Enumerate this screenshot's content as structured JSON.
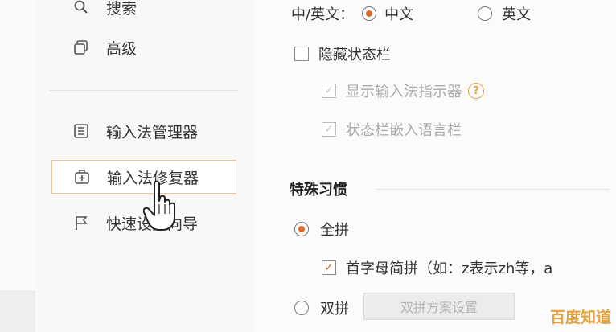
{
  "sidebar": {
    "items": [
      {
        "label": "搜索",
        "icon": "search-icon"
      },
      {
        "label": "高级",
        "icon": "advanced-icon"
      },
      {
        "label": "输入法管理器",
        "icon": "manager-icon"
      },
      {
        "label": "输入法修复器",
        "icon": "repair-icon",
        "active": true
      },
      {
        "label": "快速设置向导",
        "icon": "flag-icon"
      }
    ]
  },
  "settings": {
    "lang_label": "中/英文：",
    "lang_options": [
      {
        "label": "中文",
        "selected": true
      },
      {
        "label": "英文",
        "selected": false
      }
    ],
    "hide_status_bar": {
      "label": "隐藏状态栏",
      "checked": false
    },
    "show_indicator": {
      "label": "显示输入法指示器",
      "checked": true,
      "disabled": true
    },
    "embed_language_bar": {
      "label": "状态栏嵌入语言栏",
      "checked": true,
      "disabled": true
    },
    "special_habits_title": "特殊习惯",
    "full_pinyin": {
      "label": "全拼",
      "selected": true
    },
    "initial_abbrev": {
      "label": "首字母简拼（如：z表示zh等，a",
      "checked": true
    },
    "double_pinyin": {
      "label": "双拼",
      "selected": false
    },
    "double_pinyin_scheme_button": "双拼方案设置"
  },
  "watermark": "百度知道",
  "colors": {
    "accent": "#e06a2b",
    "active_border": "#f0c49b",
    "watermark": "#e6a23c"
  }
}
